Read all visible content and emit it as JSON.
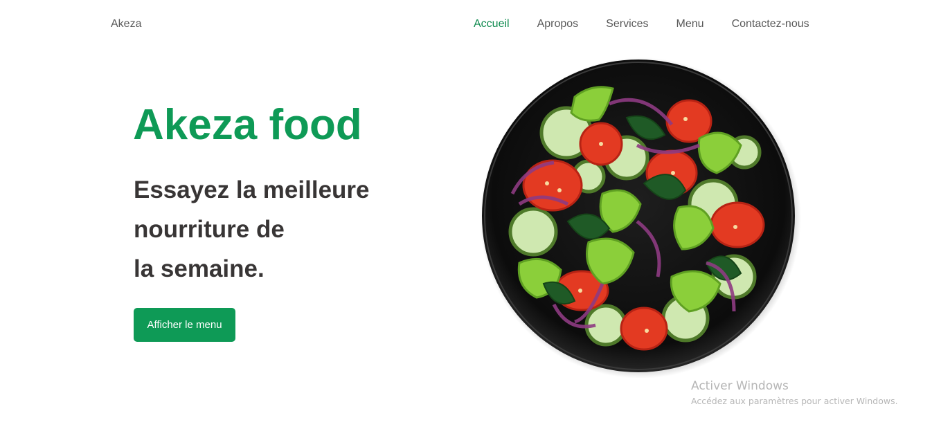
{
  "navbar": {
    "brand": "Akeza",
    "links": [
      {
        "label": "Accueil",
        "active": true
      },
      {
        "label": "Apropos",
        "active": false
      },
      {
        "label": "Services",
        "active": false
      },
      {
        "label": "Menu",
        "active": false
      },
      {
        "label": "Contactez-nous",
        "active": false
      }
    ]
  },
  "hero": {
    "title": "Akeza food",
    "subtitle_lines": [
      "Essayez la meilleure",
      "nourriture de",
      "la semaine."
    ],
    "cta_label": "Afficher le menu",
    "image_icon": "salad-bowl-image"
  },
  "watermark": {
    "title": "Activer Windows",
    "subtitle": "Accédez aux paramètres pour activer Windows."
  },
  "colors": {
    "accent": "#0e9a56",
    "active_link": "#0e8a4e",
    "text_dark": "#383535",
    "nav_text": "#595959"
  }
}
